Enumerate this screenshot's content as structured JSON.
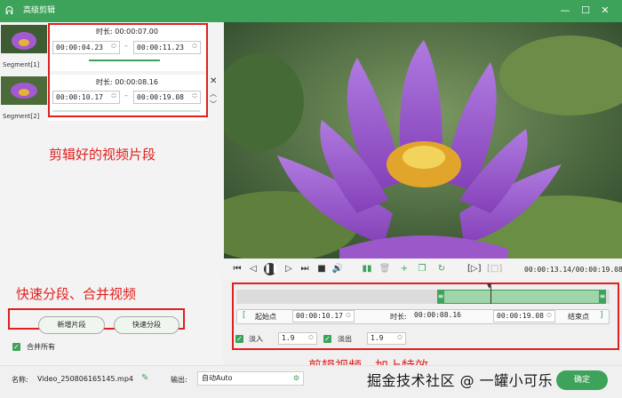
{
  "window": {
    "title": "高级剪辑",
    "minimize": "—",
    "maximize": "☐",
    "close": "✕"
  },
  "segments": [
    {
      "label": "Segment[1]",
      "duration_label": "时长:",
      "duration": "00:00:07.00",
      "start": "00:00:04.23",
      "end": "00:00:11.23"
    },
    {
      "label": "Segment[2]",
      "duration_label": "时长:",
      "duration": "00:00:08.16",
      "start": "00:00:10.17",
      "end": "00:00:19.08"
    }
  ],
  "annotations": {
    "segments": "剪辑好的视频片段",
    "split_merge": "快速分段、合并视频",
    "effects": "剪辑视频，加上特效"
  },
  "buttons": {
    "new_segment": "新增片段",
    "fast_split": "快速分段"
  },
  "merge_all": "合并所有",
  "player": {
    "time": "00:00:13.14/00:00:19.08"
  },
  "trim": {
    "start_label": "起始点",
    "start_value": "00:00:10.17",
    "duration_label": "时长:",
    "duration_value": "00:00:08.16",
    "end_value": "00:00:19.08",
    "end_label": "结束点"
  },
  "effects": {
    "fade_in_label": "淡入",
    "fade_in_value": "1.9",
    "fade_out_label": "淡出",
    "fade_out_value": "1.9"
  },
  "footer": {
    "name_label": "名称:",
    "file_name": "Video_250806165145.mp4",
    "output_label": "输出:",
    "output_value": "自动Auto",
    "ok_label": "确定"
  },
  "watermark": "掘金技术社区 @ 一罐小可乐",
  "colors": {
    "accent": "#3da35a",
    "annotation": "#e0201e"
  }
}
